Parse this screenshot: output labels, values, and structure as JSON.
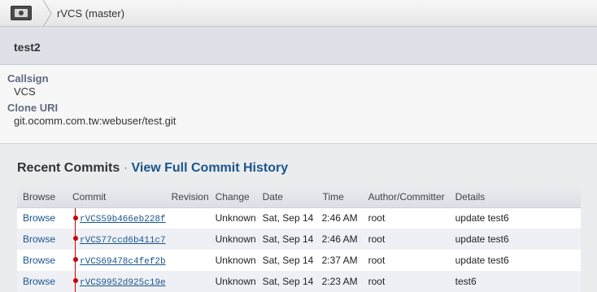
{
  "crumbs": {
    "repo_label": "rVCS (master)"
  },
  "header": {
    "title": "test2"
  },
  "properties": [
    {
      "key": "Callsign",
      "value": "VCS"
    },
    {
      "key": "Clone URI",
      "value": "git.ocomm.com.tw:webuser/test.git"
    }
  ],
  "commits_section": {
    "title": "Recent Commits",
    "separator": "·",
    "history_link": "View Full Commit History"
  },
  "table": {
    "headers": [
      "Browse",
      "Commit",
      "Revision",
      "Change",
      "Date",
      "Time",
      "Author/Committer",
      "Details"
    ],
    "rows": [
      {
        "browse": "Browse",
        "commit": "rVCS59b466eb228f",
        "revision": "",
        "change": "Unknown",
        "date": "Sat, Sep 14",
        "time": "2:46 AM",
        "author": "root",
        "details": "update test6"
      },
      {
        "browse": "Browse",
        "commit": "rVCS77ccd6b411c7",
        "revision": "",
        "change": "Unknown",
        "date": "Sat, Sep 14",
        "time": "2:46 AM",
        "author": "root",
        "details": "update test6"
      },
      {
        "browse": "Browse",
        "commit": "rVCS69478c4fef2b",
        "revision": "",
        "change": "Unknown",
        "date": "Sat, Sep 14",
        "time": "2:37 AM",
        "author": "root",
        "details": "update test6"
      },
      {
        "browse": "Browse",
        "commit": "rVCS9952d925c19e",
        "revision": "",
        "change": "Unknown",
        "date": "Sat, Sep 14",
        "time": "2:23 AM",
        "author": "root",
        "details": "test6"
      }
    ]
  },
  "colors": {
    "link": "#19558d",
    "graph": "#cc0000",
    "header_bg": "#dfe1e9"
  }
}
